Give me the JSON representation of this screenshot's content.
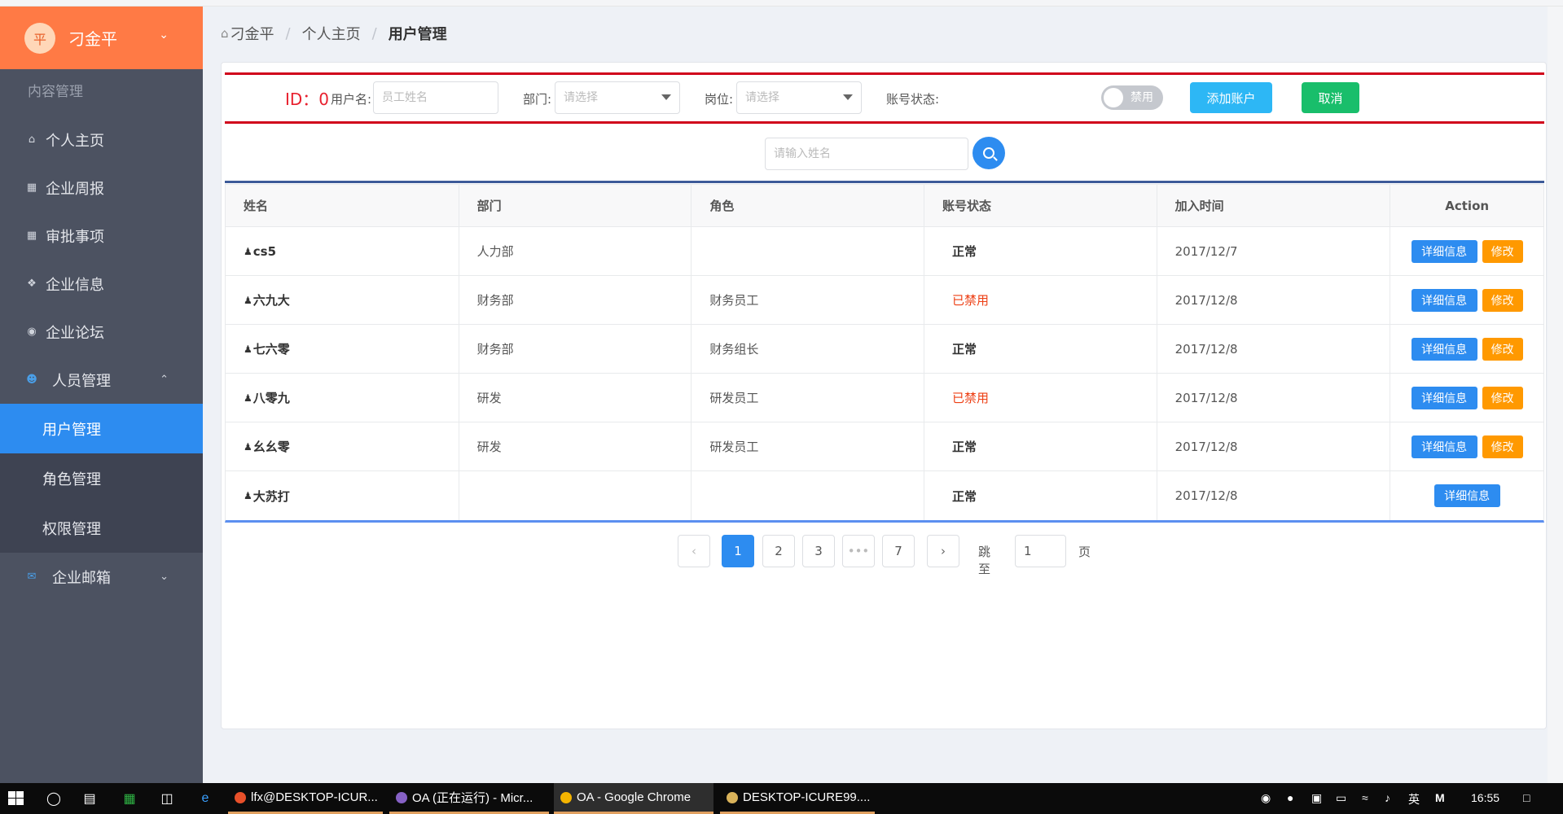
{
  "sidebar": {
    "user": {
      "avatar_char": "平",
      "name": "刁金平"
    },
    "section_label": "内容管理",
    "items": [
      {
        "label": "个人主页",
        "icon": "home-icon"
      },
      {
        "label": "企业周报",
        "icon": "document-icon"
      },
      {
        "label": "审批事项",
        "icon": "document-icon"
      },
      {
        "label": "企业信息",
        "icon": "info-icon"
      },
      {
        "label": "企业论坛",
        "icon": "forum-icon"
      }
    ],
    "group": {
      "label": "人员管理",
      "icon": "people-icon"
    },
    "sub_items": [
      {
        "label": "用户管理",
        "active": true
      },
      {
        "label": "角色管理",
        "active": false
      },
      {
        "label": "权限管理",
        "active": false
      }
    ],
    "mail": {
      "label": "企业邮箱",
      "icon": "mail-icon"
    }
  },
  "breadcrumb": {
    "home": "刁金平",
    "level1": "个人主页",
    "current": "用户管理"
  },
  "filter": {
    "id_text": "ID：0",
    "username_label": "用户名:",
    "username_placeholder": "员工姓名",
    "dept_label": "部门:",
    "dept_placeholder": "请选择",
    "post_label": "岗位:",
    "post_placeholder": "请选择",
    "status_label": "账号状态:",
    "status_toggle_text": "禁用",
    "add_button": "添加账户",
    "cancel_button": "取消"
  },
  "search": {
    "placeholder": "请输入姓名"
  },
  "table": {
    "columns": [
      "姓名",
      "部门",
      "角色",
      "账号状态",
      "加入时间",
      "Action"
    ],
    "detail_label": "详细信息",
    "edit_label": "修改",
    "rows": [
      {
        "name": "cs5",
        "dept": "人力部",
        "role": "",
        "status": "正常",
        "disabled": false,
        "joined": "2017/12/7"
      },
      {
        "name": "六九大",
        "dept": "财务部",
        "role": "财务员工",
        "status": "已禁用",
        "disabled": true,
        "joined": "2017/12/8"
      },
      {
        "name": "七六零",
        "dept": "财务部",
        "role": "财务组长",
        "status": "正常",
        "disabled": false,
        "joined": "2017/12/8"
      },
      {
        "name": "八零九",
        "dept": "研发",
        "role": "研发员工",
        "status": "已禁用",
        "disabled": true,
        "joined": "2017/12/8"
      },
      {
        "name": "幺幺零",
        "dept": "研发",
        "role": "研发员工",
        "status": "正常",
        "disabled": false,
        "joined": "2017/12/8"
      },
      {
        "name": "大苏打",
        "dept": "",
        "role": "",
        "status": "正常",
        "disabled": false,
        "joined": "2017/12/8"
      }
    ]
  },
  "pagination": {
    "pages": [
      "1",
      "2",
      "3",
      "•••",
      "7"
    ],
    "current": "1",
    "jump_label": "跳至",
    "jump_value": "1",
    "page_suffix": "页"
  },
  "taskbar": {
    "tasks": [
      {
        "label": "lfx@DESKTOP-ICUR...",
        "icon": "terminal-icon",
        "color": "#e8502a"
      },
      {
        "label": "OA (正在运行) - Micr...",
        "icon": "visual-studio-icon",
        "color": "#8661c5"
      },
      {
        "label": "OA - Google Chrome",
        "icon": "chrome-icon",
        "color": "#f4b400"
      },
      {
        "label": "DESKTOP-ICURE99....",
        "icon": "remote-desktop-icon",
        "color": "#d9b25a"
      }
    ],
    "ime": "英",
    "ime_mode": "M",
    "time": "16:55"
  },
  "colors": {
    "sidebar_bg": "#4c5261",
    "user_header_bg": "#ff7a45",
    "active_item_bg": "#2d8cf0",
    "add_button_bg": "#2db7f5",
    "cancel_button_bg": "#19be6b",
    "edit_button_bg": "#ff9900",
    "disabled_status": "#ed3f14"
  }
}
